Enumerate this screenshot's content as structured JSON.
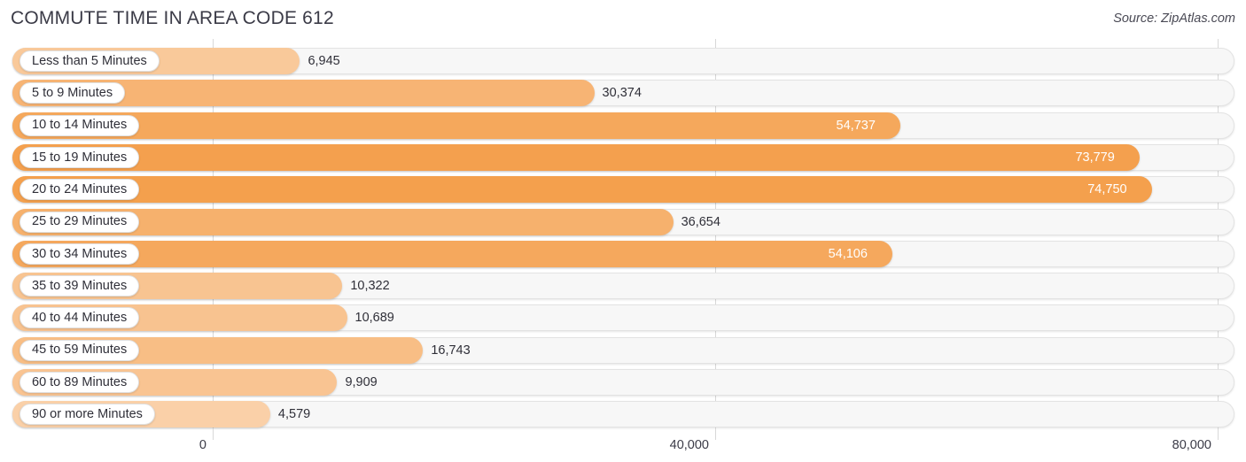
{
  "header": {
    "title": "COMMUTE TIME IN AREA CODE 612",
    "source": "Source: ZipAtlas.com"
  },
  "colors": {
    "bar_strong": "#F5A352",
    "bar_light": "#FAD0A8",
    "track": "#F7F7F7",
    "track_border": "#E3E3E3",
    "grid": "#D8D8D8",
    "text": "#2F2F38",
    "value_inside": "#FFFFFF"
  },
  "axis": {
    "ticks": [
      {
        "label": "0",
        "value": 0
      },
      {
        "label": "40,000",
        "value": 40000
      },
      {
        "label": "80,000",
        "value": 80000
      }
    ],
    "min": 0,
    "max": 80000
  },
  "chart_data": {
    "type": "bar",
    "orientation": "horizontal",
    "title": "COMMUTE TIME IN AREA CODE 612",
    "subtitle": "Source: ZipAtlas.com",
    "xlabel": "",
    "ylabel": "",
    "xlim": [
      0,
      80000
    ],
    "grid": true,
    "legend": false,
    "categories": [
      "Less than 5 Minutes",
      "5 to 9 Minutes",
      "10 to 14 Minutes",
      "15 to 19 Minutes",
      "20 to 24 Minutes",
      "25 to 29 Minutes",
      "30 to 34 Minutes",
      "35 to 39 Minutes",
      "40 to 44 Minutes",
      "45 to 59 Minutes",
      "60 to 89 Minutes",
      "90 or more Minutes"
    ],
    "values": [
      6945,
      30374,
      54737,
      73779,
      74750,
      36654,
      54106,
      10322,
      10689,
      16743,
      9909,
      4579
    ],
    "value_labels": [
      "6,945",
      "30,374",
      "54,737",
      "73,779",
      "74,750",
      "36,654",
      "54,106",
      "10,322",
      "10,689",
      "16,743",
      "9,909",
      "4,579"
    ]
  },
  "rows": [
    {
      "label": "Less than 5 Minutes",
      "value": 6945,
      "value_label": "6,945",
      "label_inside": false
    },
    {
      "label": "5 to 9 Minutes",
      "value": 30374,
      "value_label": "30,374",
      "label_inside": false
    },
    {
      "label": "10 to 14 Minutes",
      "value": 54737,
      "value_label": "54,737",
      "label_inside": true
    },
    {
      "label": "15 to 19 Minutes",
      "value": 73779,
      "value_label": "73,779",
      "label_inside": true
    },
    {
      "label": "20 to 24 Minutes",
      "value": 74750,
      "value_label": "74,750",
      "label_inside": true
    },
    {
      "label": "25 to 29 Minutes",
      "value": 36654,
      "value_label": "36,654",
      "label_inside": false
    },
    {
      "label": "30 to 34 Minutes",
      "value": 54106,
      "value_label": "54,106",
      "label_inside": true
    },
    {
      "label": "35 to 39 Minutes",
      "value": 10322,
      "value_label": "10,322",
      "label_inside": false
    },
    {
      "label": "40 to 44 Minutes",
      "value": 10689,
      "value_label": "10,689",
      "label_inside": false
    },
    {
      "label": "45 to 59 Minutes",
      "value": 16743,
      "value_label": "16,743",
      "label_inside": false
    },
    {
      "label": "60 to 89 Minutes",
      "value": 9909,
      "value_label": "9,909",
      "label_inside": false
    },
    {
      "label": "90 or more Minutes",
      "value": 4579,
      "value_label": "4,579",
      "label_inside": false
    }
  ]
}
